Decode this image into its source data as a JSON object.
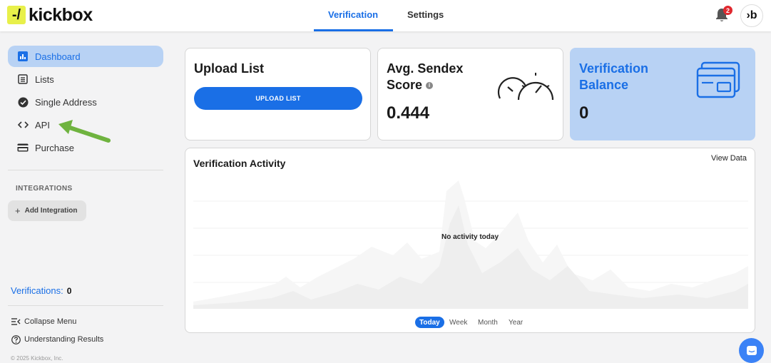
{
  "brand": {
    "logo_mark": "-/",
    "logo_text": "kickbox",
    "accent": "#1a6fe6",
    "logo_color": "#e8f04a"
  },
  "header": {
    "tabs": [
      {
        "label": "Verification",
        "active": true
      },
      {
        "label": "Settings",
        "active": false
      }
    ],
    "notifications_count": "2",
    "avatar_initials": "›b"
  },
  "sidebar": {
    "items": [
      {
        "label": "Dashboard",
        "icon": "bar-chart-icon",
        "active": true
      },
      {
        "label": "Lists",
        "icon": "list-icon",
        "active": false
      },
      {
        "label": "Single Address",
        "icon": "check-circle-icon",
        "active": false
      },
      {
        "label": "API",
        "icon": "code-icon",
        "active": false
      },
      {
        "label": "Purchase",
        "icon": "credit-card-icon",
        "active": false
      }
    ],
    "integrations_label": "INTEGRATIONS",
    "add_integration_label": "Add Integration",
    "verifications_label": "Verifications:",
    "verifications_value": "0",
    "collapse_label": "Collapse Menu",
    "understanding_label": "Understanding Results",
    "copyright": "© 2025 Kickbox, Inc."
  },
  "cards": {
    "upload": {
      "title": "Upload List",
      "button": "UPLOAD LIST"
    },
    "sendex": {
      "title_line1": "Avg. Sendex",
      "title_line2": "Score",
      "value": "0.444"
    },
    "balance": {
      "title_line1": "Verification",
      "title_line2": "Balance",
      "value": "0"
    }
  },
  "activity": {
    "title": "Verification Activity",
    "view_data": "View Data",
    "empty_message": "No activity today",
    "ranges": [
      {
        "label": "Today",
        "active": true
      },
      {
        "label": "Week",
        "active": false
      },
      {
        "label": "Month",
        "active": false
      },
      {
        "label": "Year",
        "active": false
      }
    ]
  }
}
